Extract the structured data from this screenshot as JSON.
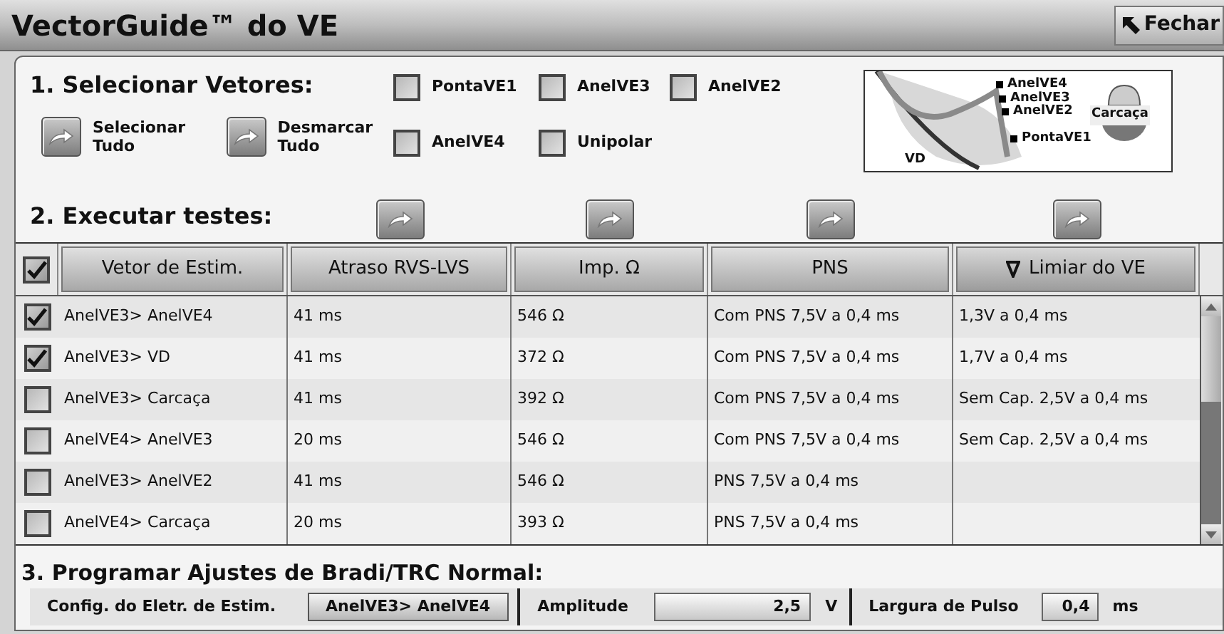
{
  "window": {
    "title": "VectorGuide™ do VE",
    "close_button": "Fechar"
  },
  "section_1": {
    "title": "1. Selecionar Vetores:",
    "buttons": [
      {
        "label": "Selecionar Tudo"
      },
      {
        "label": "Desmarcar Tudo"
      }
    ],
    "electrodes": [
      {
        "label": "PontaVE1",
        "checked": false
      },
      {
        "label": "AnelVE3",
        "checked": false
      },
      {
        "label": "AnelVE2",
        "checked": false
      },
      {
        "label": "AnelVE4",
        "checked": false
      },
      {
        "label": "Unipolar",
        "checked": false
      }
    ],
    "diagram": {
      "labels": [
        "AnelVE4",
        "AnelVE3",
        "AnelVE2",
        "PontaVE1"
      ],
      "can_label": "Carcaça",
      "rv_label": "VD"
    }
  },
  "section_2": {
    "title": "2. Executar testes:",
    "select_all_checked": true,
    "columns": [
      {
        "label": "Vetor de Estim.",
        "sorted": false,
        "run_button": false
      },
      {
        "label": "Atraso RVS-LVS",
        "sorted": false,
        "run_button": true
      },
      {
        "label": "Imp. Ω",
        "sorted": false,
        "run_button": true
      },
      {
        "label": "PNS",
        "sorted": false,
        "run_button": true
      },
      {
        "label": "Limiar do VE",
        "sorted": true,
        "run_button": true
      }
    ],
    "rows": [
      {
        "checked": true,
        "cells": [
          "AnelVE3> AnelVE4",
          "41 ms",
          "546 Ω",
          "Com PNS 7,5V a 0,4 ms",
          "1,3V a 0,4 ms"
        ]
      },
      {
        "checked": true,
        "cells": [
          "AnelVE3> VD",
          "41 ms",
          "372 Ω",
          "Com PNS 7,5V a 0,4 ms",
          "1,7V a 0,4 ms"
        ]
      },
      {
        "checked": false,
        "cells": [
          "AnelVE3> Carcaça",
          "41 ms",
          "392 Ω",
          "Com PNS 7,5V a 0,4 ms",
          "Sem Cap. 2,5V a 0,4 ms"
        ]
      },
      {
        "checked": false,
        "cells": [
          "AnelVE4> AnelVE3",
          "20 ms",
          "546 Ω",
          "Com PNS 7,5V a 0,4 ms",
          "Sem Cap. 2,5V a 0,4 ms"
        ]
      },
      {
        "checked": false,
        "cells": [
          "AnelVE3> AnelVE2",
          "41 ms",
          "546 Ω",
          "PNS 7,5V a 0,4 ms",
          ""
        ]
      },
      {
        "checked": false,
        "cells": [
          "AnelVE4> Carcaça",
          "20 ms",
          "393 Ω",
          "PNS 7,5V a 0,4 ms",
          ""
        ]
      }
    ]
  },
  "section_3": {
    "title": "3. Programar Ajustes de Bradi/TRC Normal:",
    "vector_label": "Config. do Eletr. de Estim.",
    "vector_value": "AnelVE3> AnelVE4",
    "amplitude_label": "Amplitude",
    "amplitude_value": "2,5",
    "amplitude_unit": "V",
    "pulse_label": "Largura de Pulso",
    "pulse_value": "0,4",
    "pulse_unit": "ms"
  }
}
